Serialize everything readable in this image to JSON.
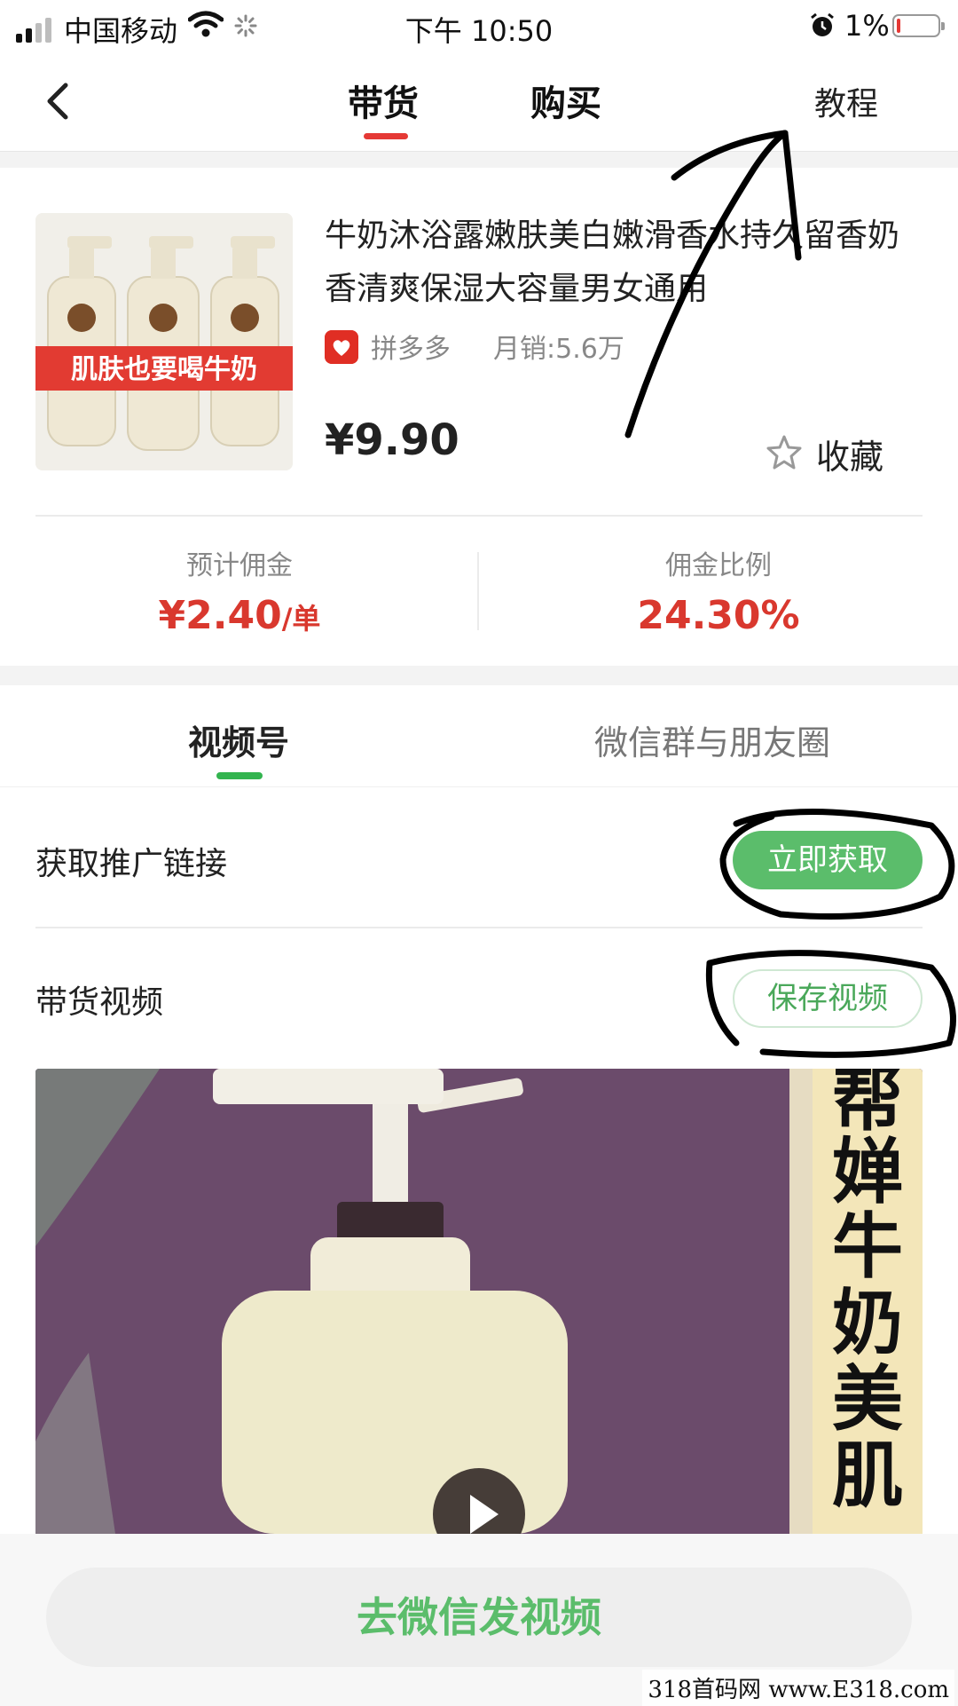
{
  "status_bar": {
    "carrier": "中国移动",
    "time": "下午 10:50",
    "battery": "1%",
    "icons": [
      "signal-icon",
      "wifi-icon",
      "loading-spinner-icon",
      "alarm-icon",
      "battery-icon"
    ]
  },
  "nav": {
    "tabs": [
      {
        "label": "带货"
      },
      {
        "label": "购买"
      }
    ],
    "tutorial": "教程",
    "active_tab_color": "#e53935"
  },
  "product": {
    "image_banner": "肌肤也要喝牛奶",
    "title": "牛奶沐浴露嫩肤美白嫩滑香水持久留香奶香清爽保湿大容量男女通用",
    "platform": "拼多多",
    "monthly_sales": "月销:5.6万",
    "price": "¥9.90",
    "favorite": "收藏"
  },
  "stats": {
    "commission_label": "预计佣金",
    "commission_value": "¥2.40",
    "commission_unit": "/单",
    "ratio_label": "佣金比例",
    "ratio_value": "24.30%",
    "value_color": "#d9382e"
  },
  "section_tabs": [
    {
      "label": "视频号"
    },
    {
      "label": "微信群与朋友圈"
    }
  ],
  "promo_link": {
    "label": "获取推广链接",
    "button": "立即获取"
  },
  "video": {
    "label": "带货视频",
    "button": "保存视频",
    "caption": [
      "帮",
      "婵",
      "牛",
      "奶",
      "美",
      "肌"
    ]
  },
  "bottom_button": "去微信发视频",
  "watermark": "318首码网 www.E318.com",
  "accent_green": "#5bbd6b"
}
